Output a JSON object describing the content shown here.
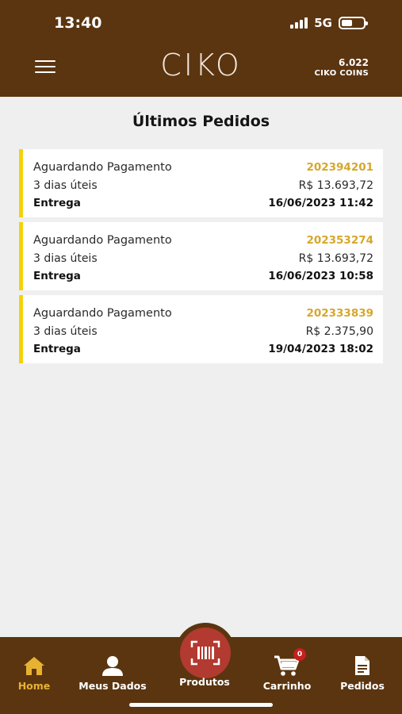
{
  "status_bar": {
    "time": "13:40",
    "network": "5G"
  },
  "header": {
    "logo": "CIKO",
    "coins_amount": "6.022",
    "coins_label": "CIKO COINS"
  },
  "page": {
    "title": "Últimos Pedidos"
  },
  "orders": [
    {
      "status": "Aguardando Pagamento",
      "code": "202394201",
      "term": "3 dias úteis",
      "price": "R$ 13.693,72",
      "type": "Entrega",
      "date": "16/06/2023 11:42"
    },
    {
      "status": "Aguardando Pagamento",
      "code": "202353274",
      "term": "3 dias úteis",
      "price": "R$ 13.693,72",
      "type": "Entrega",
      "date": "16/06/2023 10:58"
    },
    {
      "status": "Aguardando Pagamento",
      "code": "202333839",
      "term": "3 dias úteis",
      "price": "R$ 2.375,90",
      "type": "Entrega",
      "date": "19/04/2023 18:02"
    }
  ],
  "bottom_nav": {
    "home": "Home",
    "my_data": "Meus Dados",
    "products": "Produtos",
    "cart": "Carrinho",
    "cart_count": "0",
    "orders": "Pedidos"
  },
  "colors": {
    "brand_brown": "#5b3510",
    "accent_yellow": "#f4d10a",
    "code_gold": "#d6a72b",
    "active_nav": "#e7b231",
    "center_red": "#b23a30"
  },
  "icons": [
    "hamburger-icon",
    "home-icon",
    "user-icon",
    "barcode-scan-icon",
    "cart-icon",
    "orders-document-icon"
  ]
}
